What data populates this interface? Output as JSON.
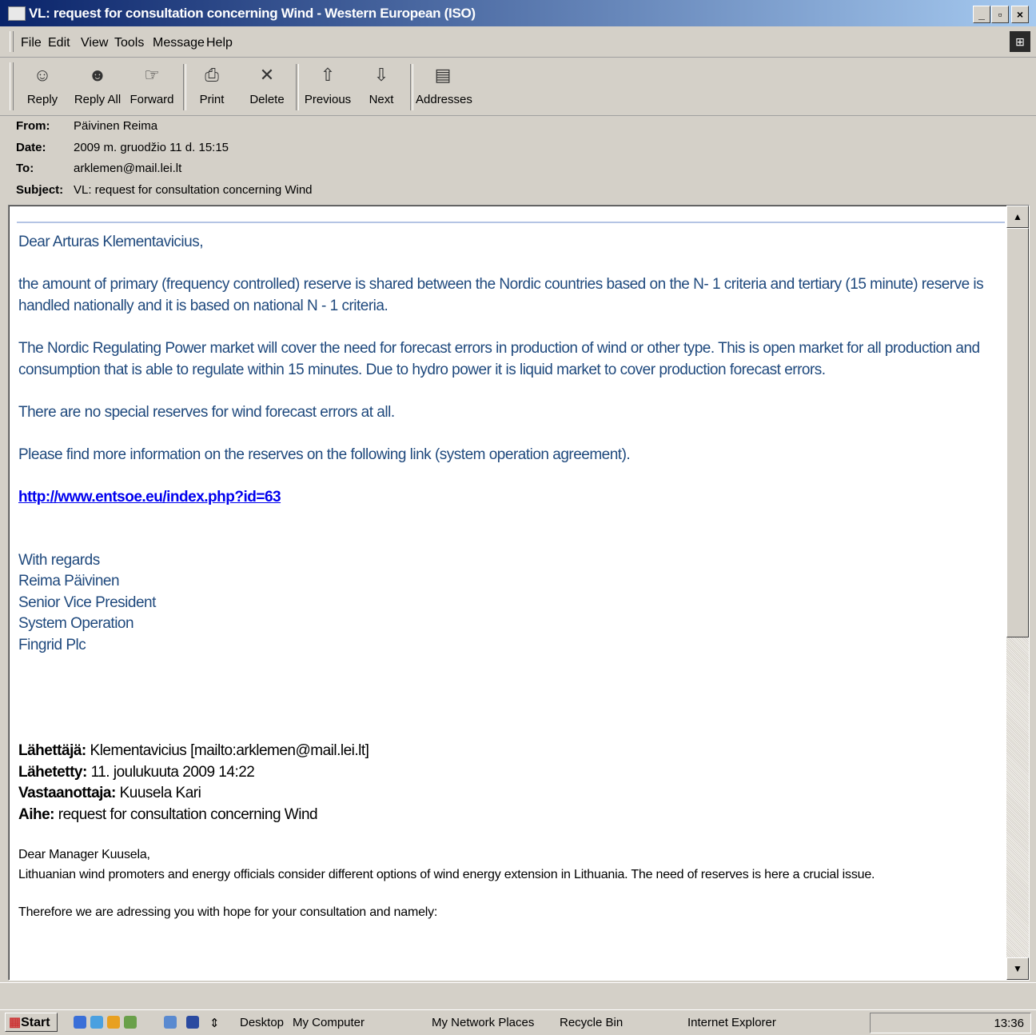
{
  "window": {
    "title": "VL: request for consultation concerning Wind - Western European (ISO)"
  },
  "menu": [
    "File",
    "Edit",
    "View",
    "Tools",
    "Message",
    "Help"
  ],
  "toolbar": [
    {
      "label": "Reply",
      "icon": "reply-icon"
    },
    {
      "label": "Reply All",
      "icon": "reply-all-icon"
    },
    {
      "label": "Forward",
      "icon": "forward-icon"
    },
    {
      "label": "Print",
      "icon": "print-icon"
    },
    {
      "label": "Delete",
      "icon": "delete-icon"
    },
    {
      "label": "Previous",
      "icon": "up-arrow-icon"
    },
    {
      "label": "Next",
      "icon": "down-arrow-icon"
    },
    {
      "label": "Addresses",
      "icon": "address-book-icon"
    }
  ],
  "header": {
    "from_label": "From:",
    "from": "Päivinen Reima",
    "date_label": "Date:",
    "date": "2009 m. gruodžio 11 d. 15:15",
    "to_label": "To:",
    "to": "arklemen@mail.lei.lt",
    "subject_label": "Subject:",
    "subject": "VL: request for consultation concerning Wind"
  },
  "body": {
    "greeting": "Dear Arturas Klementavicius,",
    "p1": "the amount of primary (frequency controlled) reserve is shared between the Nordic countries based on the N- 1 criteria and tertiary (15 minute) reserve is handled nationally and it  is based on national N - 1 criteria.",
    "p2": "The Nordic Regulating Power market  will cover the need for forecast errors in production of wind or other type. This is open market for all production and consumption that is able to regulate within 15 minutes. Due to hydro power it is liquid market to cover production forecast errors.",
    "p3": "There are no special reserves for wind forecast errors at all.",
    "p4": "Please find more information on the reserves on the following link (system operation agreement).",
    "link": "http://www.entsoe.eu/index.php?id=63",
    "sig1": "With regards",
    "sig2": "Reima Päivinen",
    "sig3": "Senior Vice President",
    "sig4": "System Operation",
    "sig5": "Fingrid Plc",
    "fw_from_label": "Lähettäjä:",
    "fw_from": "Klementavicius [mailto:arklemen@mail.lei.lt]",
    "fw_sent_label": "Lähetetty:",
    "fw_sent": "11. joulukuuta 2009 14:22",
    "fw_to_label": "Vastaanottaja:",
    "fw_to": "Kuusela Kari",
    "fw_subject_label": "Aihe:",
    "fw_subject": "request for consultation concerning Wind",
    "q_greeting": "Dear Manager Kuusela,",
    "q1": "Lithuanian wind promoters and energy officials consider different options of wind energy extension in Lithuania. The need of reserves is here a crucial issue.",
    "q2": "Therefore we are adressing you with hope for your consultation and namely:"
  },
  "taskbar": {
    "start": "Start",
    "items": [
      "Desktop",
      "My Computer",
      "My Network Places",
      "Recycle Bin",
      "Internet Explorer"
    ],
    "clock": "13:36"
  }
}
